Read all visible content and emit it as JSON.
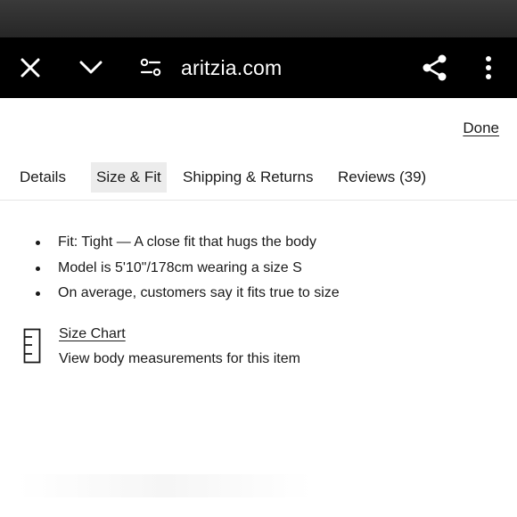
{
  "browser": {
    "url": "aritzia.com",
    "icons": [
      "close-icon",
      "chevron-down-icon",
      "site-settings-icon",
      "share-icon",
      "more-vertical-icon"
    ]
  },
  "done_label": "Done",
  "tabs": [
    {
      "label": "Details",
      "selected": false
    },
    {
      "label": "Size & Fit",
      "selected": true
    },
    {
      "label": "Shipping & Returns",
      "selected": false
    },
    {
      "label": "Reviews (39)",
      "selected": false
    }
  ],
  "fit_points": [
    "Fit: Tight — A close fit that hugs the body",
    "Model is 5'10\"/178cm wearing a size S",
    "On average, customers say it fits true to size"
  ],
  "size_chart": {
    "icon": "ruler-icon",
    "link_label": "Size Chart",
    "description": "View body measurements for this item"
  },
  "colors": {
    "browser_bar": "#000000",
    "selected_tab_bg": "#ececec",
    "text": "#1a1a1a"
  }
}
